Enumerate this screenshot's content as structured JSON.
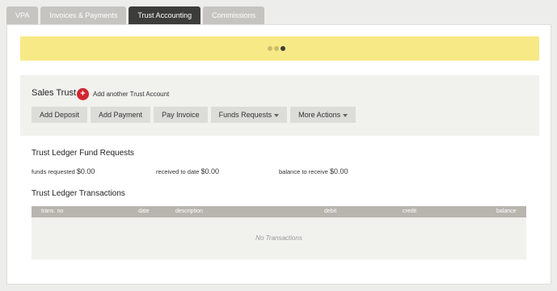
{
  "tabs": [
    {
      "label": "VPA"
    },
    {
      "label": "Invoices & Payments"
    },
    {
      "label": "Trust Accounting"
    },
    {
      "label": "Commissions"
    }
  ],
  "account": {
    "title": "Sales Trust",
    "add_label": "Add another Trust Account",
    "actions": {
      "add_deposit": "Add Deposit",
      "add_payment": "Add Payment",
      "pay_invoice": "Pay Invoice",
      "funds_requests": "Funds Requests",
      "more_actions": "More Actions"
    }
  },
  "fund_requests": {
    "title": "Trust Ledger Fund Requests",
    "requested_label": "funds requested",
    "requested_value": "$0.00",
    "received_label": "received to date",
    "received_value": "$0.00",
    "balance_label": "balance to receive",
    "balance_value": "$0.00"
  },
  "transactions": {
    "title": "Trust Ledger Transactions",
    "columns": {
      "trans_no": "trans. no",
      "date": "date",
      "description": "description",
      "debit": "debit",
      "credit": "credit",
      "balance": "balance"
    },
    "empty": "No Transactions"
  },
  "colors": {
    "banner": "#f7e986",
    "active_tab": "#3c3c3b",
    "add_icon": "#d0262f"
  }
}
